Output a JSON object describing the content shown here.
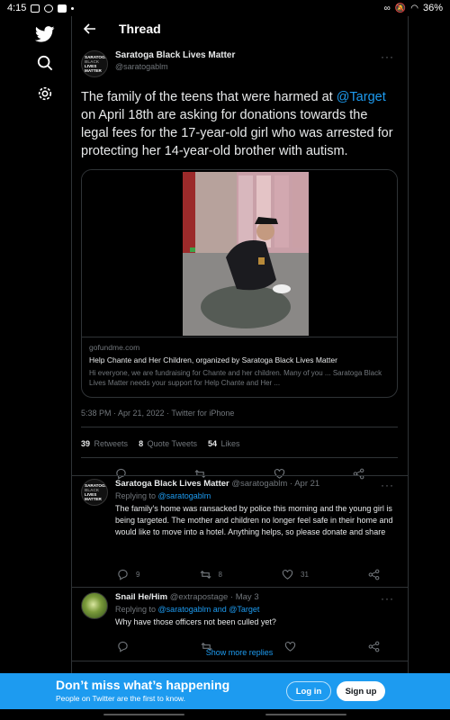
{
  "status_bar": {
    "time": "4:15",
    "battery": "36%"
  },
  "rail": {
    "icons": [
      "twitter-bird-icon",
      "search-icon",
      "gear-icon"
    ]
  },
  "header": {
    "title": "Thread"
  },
  "main_tweet": {
    "avatar_text": [
      "SARATOGA",
      "BLACK",
      "LIVES",
      "MATTER"
    ],
    "author_name": "Saratoga Black Lives Matter",
    "author_handle": "@saratogablm",
    "text_before": "The family of the teens that were harmed at ",
    "mention": "@Target",
    "text_after": " on April 18th are asking for donations towards the legal fees for the 17-year-old girl who was arrested for protecting her 14-year-old brother with autism.",
    "card": {
      "domain": "gofundme.com",
      "title": "Help Chante and Her Children, organized by Saratoga Black Lives Matter",
      "description": "Hi everyone, we are fundraising for Chante and her children. Many of you ... Saratoga Black Lives Matter needs your support for Help Chante and Her ..."
    },
    "timestamp": "5:38 PM · Apr 21, 2022 · Twitter for iPhone",
    "retweets": "39",
    "retweets_label": "Retweets",
    "quotes": "8",
    "quotes_label": "Quote Tweets",
    "likes": "54",
    "likes_label": "Likes"
  },
  "replies": [
    {
      "author_name": "Saratoga Black Lives Matter",
      "meta": "@saratogablm · Apr 21",
      "replying_label": "Replying to",
      "replying_to": "@saratogablm",
      "text": "The family's home was ransacked by police this morning and the young girl is being targeted. The mother and children no longer feel safe in their home and would like to move into a hotel. Anything helps, so please donate and share",
      "reply_count": "9",
      "retweet_count": "8",
      "like_count": "31"
    },
    {
      "author_name": "Snail He/Him",
      "meta": "@extrapostage · May 3",
      "replying_label": "Replying to",
      "replying_to": "@saratogablm and @Target",
      "text": "Why have those officers not been culled yet?"
    }
  ],
  "show_more": "Show more replies",
  "banner": {
    "title": "Don’t miss what’s happening",
    "subtitle": "People on Twitter are the first to know.",
    "login": "Log in",
    "signup": "Sign up"
  }
}
